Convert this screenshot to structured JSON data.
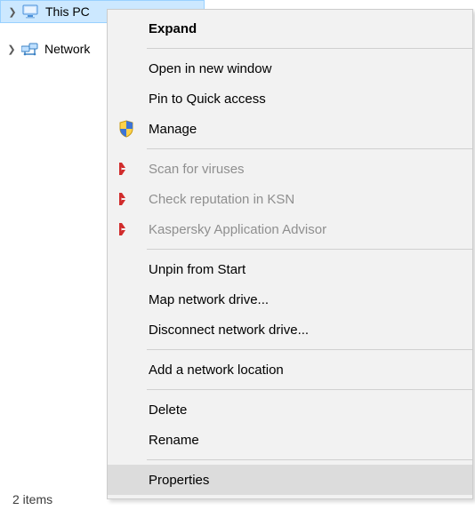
{
  "tree": {
    "this_pc": {
      "label": "This PC",
      "expand_glyph": "❯"
    },
    "network": {
      "label": "Network",
      "expand_glyph": "❯"
    }
  },
  "status": {
    "items_text": "2 items"
  },
  "menu": {
    "expand": "Expand",
    "open_new": "Open in new window",
    "pin_quick": "Pin to Quick access",
    "manage": "Manage",
    "scan_virus": "Scan for viruses",
    "check_ksn": "Check reputation in KSN",
    "kasp_advisor": "Kaspersky Application Advisor",
    "unpin_start": "Unpin from Start",
    "map_drive": "Map network drive...",
    "disc_drive": "Disconnect network drive...",
    "add_loc": "Add a network location",
    "delete": "Delete",
    "rename": "Rename",
    "properties": "Properties"
  }
}
